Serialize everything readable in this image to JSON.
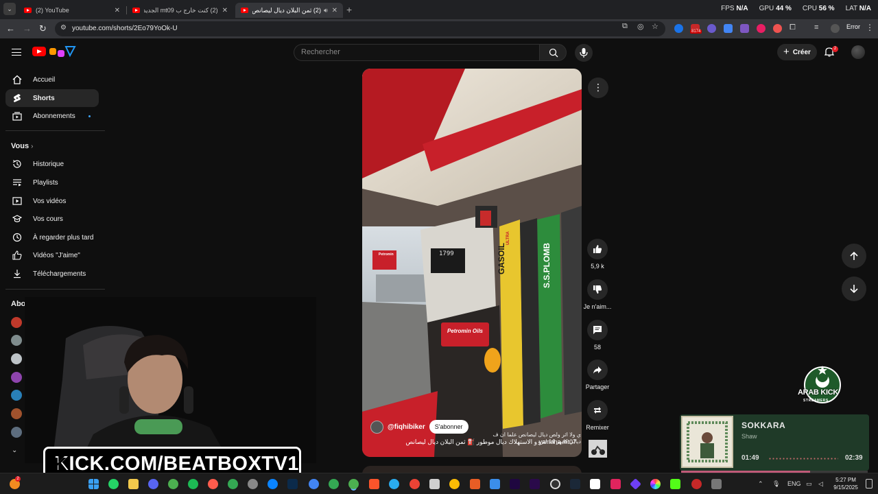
{
  "tabs": [
    {
      "title": "(2) YouTube",
      "active": false
    },
    {
      "title": "(2) كنت خارج ب mt09 الجديدة، ش...",
      "active": false
    },
    {
      "title": "(2) ثمن البلان ديال ليصانص ⛽",
      "active": true
    }
  ],
  "perf": {
    "fps_label": "FPS",
    "fps_value": "N/A",
    "gpu_label": "GPU",
    "gpu_value": "44 %",
    "cpu_label": "CPU",
    "cpu_value": "56 %",
    "lat_label": "LAT",
    "lat_value": "N/A"
  },
  "address": {
    "url": "youtube.com/shorts/2Eo79YoOk-U",
    "error_label": "Error",
    "ext_badge": "8174"
  },
  "header": {
    "search_placeholder": "Rechercher",
    "create_label": "Créer",
    "notif_count": "2"
  },
  "sidebar": {
    "main": [
      {
        "label": "Accueil",
        "icon": "home-icon"
      },
      {
        "label": "Shorts",
        "icon": "shorts-icon"
      },
      {
        "label": "Abonnements",
        "icon": "subscriptions-icon"
      }
    ],
    "vous_label": "Vous",
    "vous_items": [
      {
        "label": "Historique",
        "icon": "history-icon"
      },
      {
        "label": "Playlists",
        "icon": "playlists-icon"
      },
      {
        "label": "Vos vidéos",
        "icon": "your-videos-icon"
      },
      {
        "label": "Vos cours",
        "icon": "courses-icon"
      },
      {
        "label": "À regarder plus tard",
        "icon": "watch-later-icon"
      },
      {
        "label": "Vidéos \"J'aime\"",
        "icon": "liked-icon"
      },
      {
        "label": "Téléchargements",
        "icon": "downloads-icon"
      }
    ],
    "subs_label": "Abo"
  },
  "short": {
    "channel": "@fiqhibiker",
    "subscribe_label": "S'abonner",
    "caption": "yamaha mt07 و الاستهلاك ديال موطور ⛽ ثمن البلان ديال ليصانص",
    "overlay_text": "ي ولا اثر ولص ديال ليصانص علما ان ف ديالي كايهز 14 لترو",
    "likes": "5,9 k",
    "dislike_label": "Je n'aim...",
    "comments": "58",
    "share_label": "Partager",
    "remix_label": "Remixer",
    "pump_sign": "Petromin Oils",
    "gasoil_label": "GASOIL",
    "ultra_label": "ULTRA",
    "ssplomb_label": "S.S.PLOMB",
    "pump_display": "1799",
    "station_sign": "Petromin"
  },
  "overlay": {
    "kick_url": "KICK.COM/BEATBOXTV1",
    "arab_kick_title": "ARAB KICK",
    "arab_kick_sub": "STREAMERS"
  },
  "music": {
    "title": "SOKKARA",
    "artist": "Shaw",
    "elapsed": "01:49",
    "total": "02:39",
    "progress": 0.69
  },
  "taskbar": {
    "lang": "ENG",
    "time": "5:27 PM",
    "date": "9/15/2025",
    "weather_badge": "2"
  },
  "colors": {
    "accent_red": "#ff0000",
    "kick_green": "#53fc18",
    "link_blue": "#3ea6ff",
    "music_bg": "#1f3a28"
  }
}
